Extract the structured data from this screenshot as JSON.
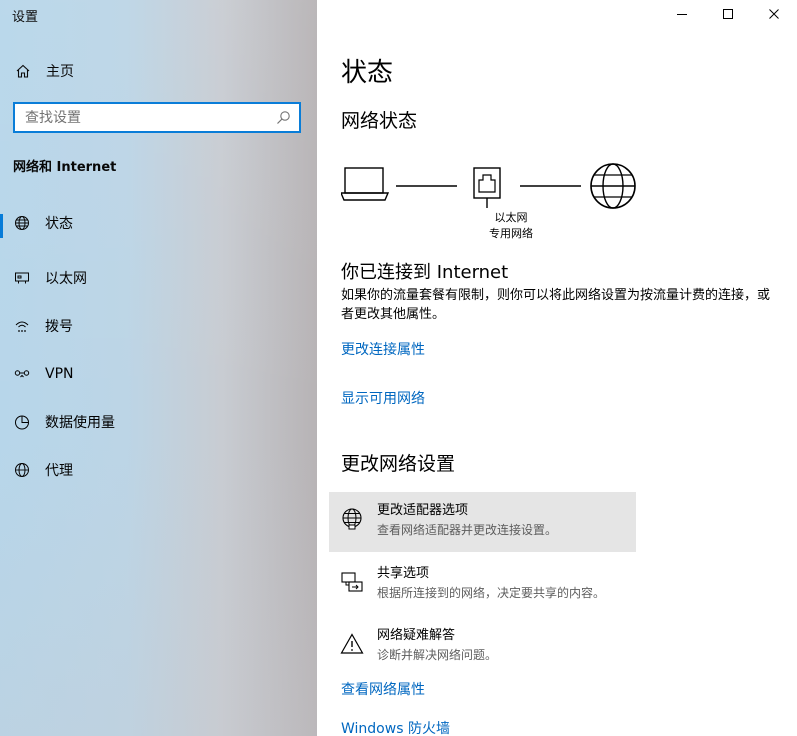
{
  "window": {
    "title": "设置",
    "controls": [
      "minimize-icon",
      "maximize-icon",
      "close-icon"
    ]
  },
  "sidebar": {
    "home_label": "主页",
    "search_placeholder": "查找设置",
    "section_label": "网络和 Internet",
    "items": [
      {
        "label": "状态",
        "icon": "globe-status-icon",
        "active": true
      },
      {
        "label": "以太网",
        "icon": "ethernet-icon",
        "active": false
      },
      {
        "label": "拨号",
        "icon": "dialup-icon",
        "active": false
      },
      {
        "label": "VPN",
        "icon": "vpn-icon",
        "active": false
      },
      {
        "label": "数据使用量",
        "icon": "data-usage-icon",
        "active": false
      },
      {
        "label": "代理",
        "icon": "proxy-globe-icon",
        "active": false
      }
    ],
    "accent_color": "#0078d7"
  },
  "main": {
    "title": "状态",
    "network_status_heading": "网络状态",
    "diagram": {
      "device_label_line1": "以太网",
      "device_label_line2": "专用网络"
    },
    "connected_title": "你已连接到 Internet",
    "connected_desc": "如果你的流量套餐有限制，则你可以将此网络设置为按流量计费的连接，或者更改其他属性。",
    "link_change_props": "更改连接属性",
    "link_show_networks": "显示可用网络",
    "change_heading": "更改网络设置",
    "options": [
      {
        "title": "更改适配器选项",
        "desc": "查看网络适配器并更改连接设置。",
        "icon": "adapter-globe-icon"
      },
      {
        "title": "共享选项",
        "desc": "根据所连接到的网络，决定要共享的内容。",
        "icon": "sharing-icon"
      },
      {
        "title": "网络疑难解答",
        "desc": "诊断并解决网络问题。",
        "icon": "warning-icon"
      }
    ],
    "link_view_props": "查看网络属性",
    "link_firewall": "Windows 防火墙",
    "link_color": "#0067c0"
  }
}
